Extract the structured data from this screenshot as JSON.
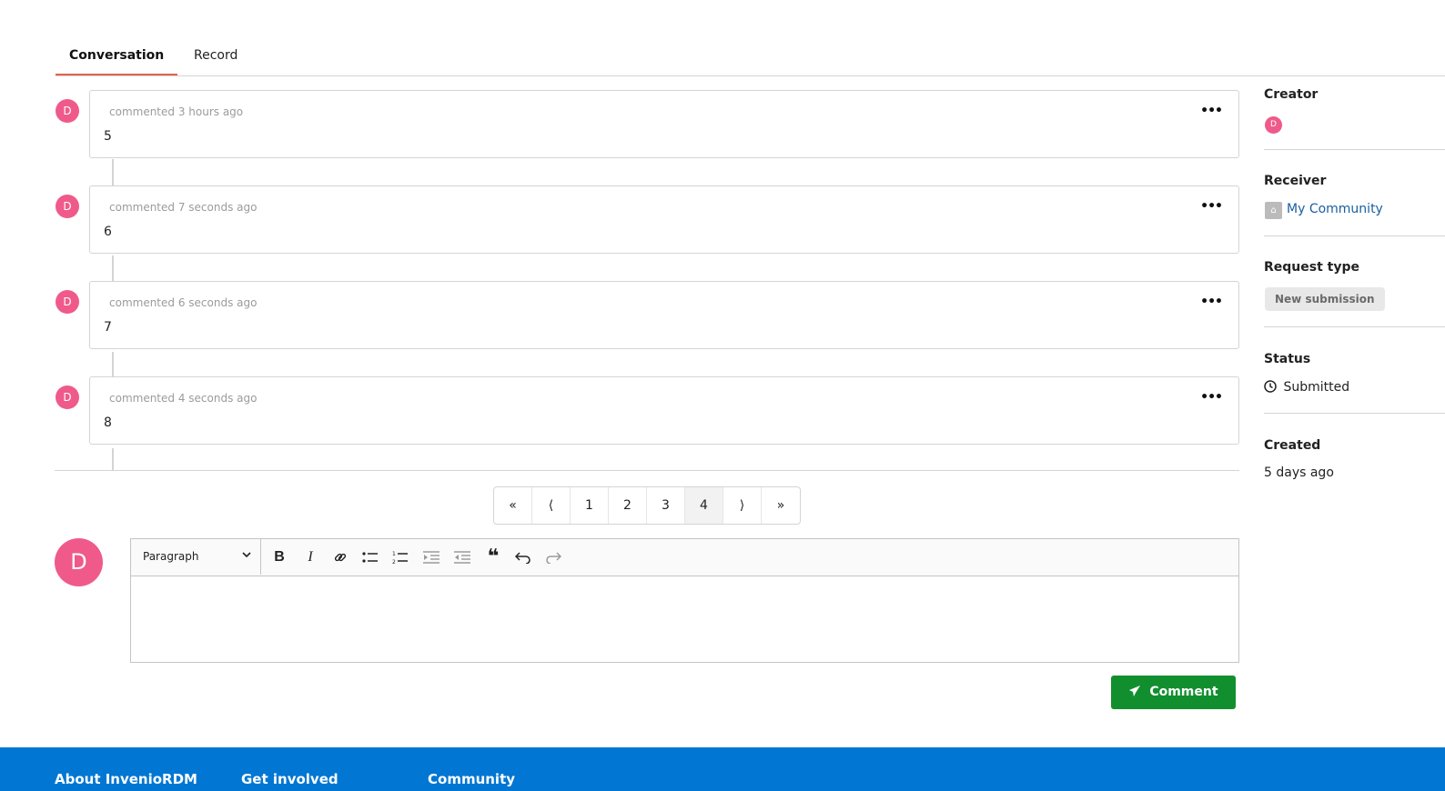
{
  "tabs": [
    {
      "label": "Conversation",
      "active": true
    },
    {
      "label": "Record",
      "active": false
    }
  ],
  "comments": [
    {
      "avatar": "D",
      "meta": "commented 3 hours ago",
      "text": "5",
      "menu": "•••"
    },
    {
      "avatar": "D",
      "meta": "commented 7 seconds ago",
      "text": "6",
      "menu": "•••"
    },
    {
      "avatar": "D",
      "meta": "commented 6 seconds ago",
      "text": "7",
      "menu": "•••"
    },
    {
      "avatar": "D",
      "meta": "commented 4 seconds ago",
      "text": "8",
      "menu": "•••"
    }
  ],
  "pagination": {
    "first": "«",
    "prev": "⟨",
    "pages": [
      "1",
      "2",
      "3",
      "4"
    ],
    "active_page": "4",
    "next": "⟩",
    "last": "»"
  },
  "editor": {
    "avatar": "D",
    "block_format": "Paragraph",
    "toolbar_icons": [
      "chevron-down-icon",
      "bold-icon",
      "italic-icon",
      "link-icon",
      "bulleted-list-icon",
      "numbered-list-icon",
      "indent-icon",
      "outdent-icon",
      "blockquote-icon",
      "undo-icon",
      "redo-icon"
    ]
  },
  "submit": {
    "label": "Comment",
    "icon": "paper-plane-icon",
    "color": "#118f2e"
  },
  "sidebar": {
    "creator": {
      "heading": "Creator",
      "avatar": "D"
    },
    "receiver": {
      "heading": "Receiver",
      "name": "My Community"
    },
    "request_type": {
      "heading": "Request type",
      "value": "New submission"
    },
    "status": {
      "heading": "Status",
      "value": "Submitted",
      "icon": "clock-icon"
    },
    "created": {
      "heading": "Created",
      "value": "5 days ago"
    }
  },
  "footer": {
    "color": "#0176d3",
    "items": [
      "About InvenioRDM",
      "Get involved",
      "Community"
    ]
  },
  "colors": {
    "accent": "#e4614b",
    "avatar": "#ef5a8b",
    "link": "#1a5fa0"
  }
}
